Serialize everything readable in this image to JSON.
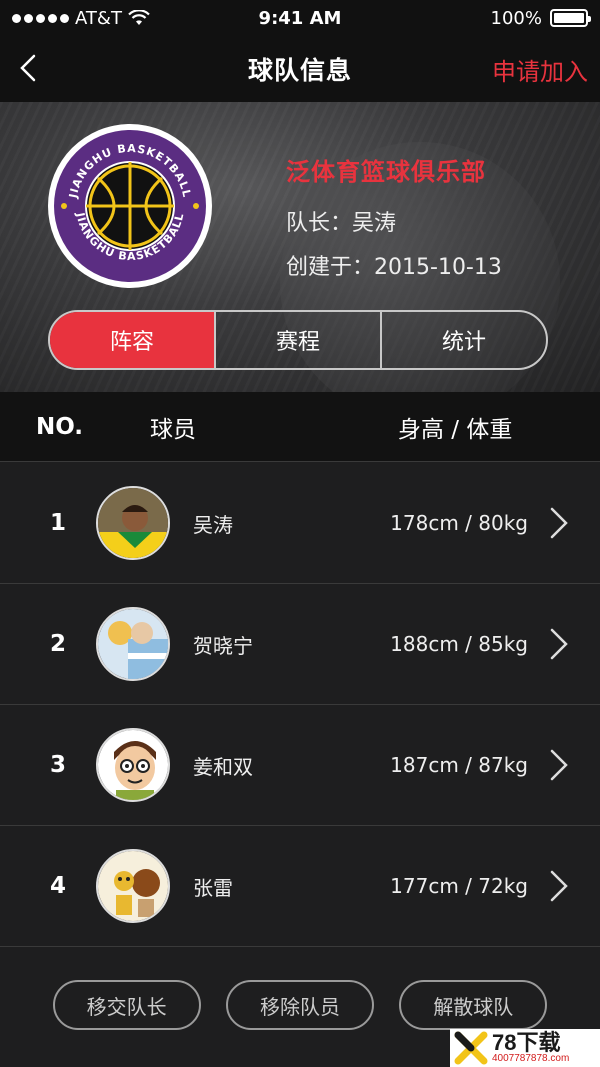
{
  "status_bar": {
    "carrier": "AT&T",
    "time": "9:41 AM",
    "battery": "100%",
    "battery_level": 1.0
  },
  "nav": {
    "title": "球队信息",
    "action": "申请加入",
    "back_icon": "chevron-left-icon"
  },
  "team": {
    "name": "泛体育篮球俱乐部",
    "captain_label": "队长：",
    "captain": "吴涛",
    "created_label": "创建于：",
    "created": "2015-10-13",
    "logo_text_top": "JIANGHU BASKETBALL",
    "logo_text_bottom": "JIANGHU BASKETBALL"
  },
  "tabs": [
    {
      "label": "阵容",
      "active": true
    },
    {
      "label": "赛程",
      "active": false
    },
    {
      "label": "统计",
      "active": false
    }
  ],
  "table_header": {
    "no": "NO.",
    "player": "球员",
    "height_weight": "身高 / 体重"
  },
  "players": [
    {
      "no": "1",
      "name": "吴涛",
      "hw": "178cm / 80kg"
    },
    {
      "no": "2",
      "name": "贺晓宁",
      "hw": "188cm / 85kg"
    },
    {
      "no": "3",
      "name": "姜和双",
      "hw": "187cm / 87kg"
    },
    {
      "no": "4",
      "name": "张雷",
      "hw": "177cm / 72kg"
    }
  ],
  "actions": {
    "transfer": "移交队长",
    "remove": "移除队员",
    "disband": "解散球队"
  },
  "watermark": {
    "main": "78下载",
    "sub": "4007787878.com"
  },
  "colors": {
    "accent": "#e8333e",
    "background": "#1e1e1f",
    "header": "#111111",
    "logo_purple": "#5b2d82",
    "logo_gold": "#f2c419"
  }
}
